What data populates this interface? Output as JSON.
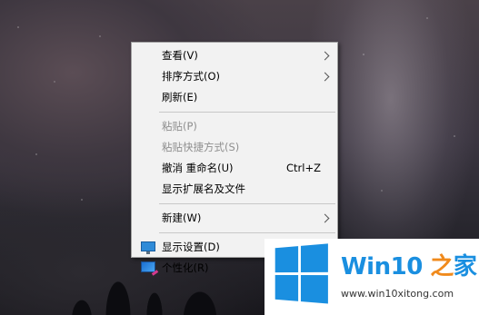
{
  "context_menu": {
    "items": [
      {
        "label": "查看(V)",
        "has_submenu": true
      },
      {
        "label": "排序方式(O)",
        "has_submenu": true
      },
      {
        "label": "刷新(E)"
      },
      {
        "label": "粘贴(P)",
        "disabled": true
      },
      {
        "label": "粘贴快捷方式(S)",
        "disabled": true
      },
      {
        "label": "撤消 重命名(U)",
        "shortcut": "Ctrl+Z"
      },
      {
        "label": "显示扩展名及文件"
      },
      {
        "label": "新建(W)",
        "has_submenu": true
      },
      {
        "label": "显示设置(D)",
        "icon": "display-settings-icon"
      },
      {
        "label": "个性化(R)",
        "icon": "personalize-icon"
      }
    ]
  },
  "watermark": {
    "brand_prefix": "Win10",
    "brand_accent": " 之",
    "brand_suffix": "家",
    "url": "www.win10xitong.com",
    "colors": {
      "blue": "#1a8fe0",
      "orange": "#f08a1c"
    }
  }
}
